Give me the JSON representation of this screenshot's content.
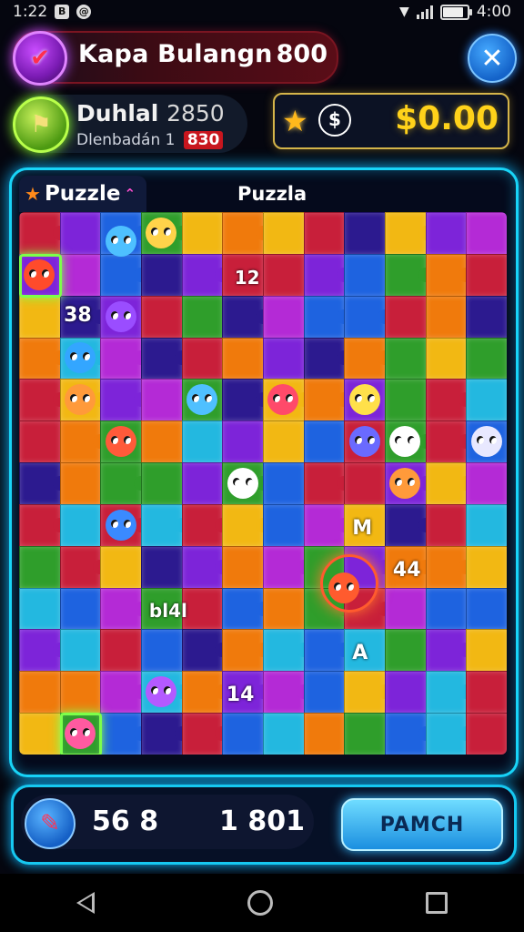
{
  "status_bar": {
    "time": "1:22",
    "clock": "4:00"
  },
  "header": {
    "title": "Kapa Bulangn",
    "count": "800"
  },
  "player": {
    "name": "Duhlal",
    "score": "2850",
    "subtitle": "Dlenbadán",
    "sub_num": "1",
    "badge": "830"
  },
  "wallet": {
    "amount": "$0.00"
  },
  "board_tabs": {
    "tab_label": "Puzzle",
    "title": "Puzzla"
  },
  "board_labels": [
    "12",
    "38",
    "M",
    "44",
    "bl4l",
    "14",
    "A"
  ],
  "footer": {
    "left_value": "56 8",
    "right_value": "1 801",
    "action_label": "PAMCH"
  },
  "colors": {
    "accent_cyan": "#18d4f7",
    "gold": "#ffd21a",
    "piece_palette": [
      "#2f9e2b",
      "#7d24d9",
      "#f07a0c",
      "#1e63e0",
      "#c81f3a",
      "#f2b813",
      "#2c1a8f",
      "#23b8e0",
      "#b42ad6"
    ]
  },
  "icons": {
    "heart": "heart-icon",
    "close": "close-icon",
    "level": "trophy-icon",
    "star": "star-icon",
    "dollar": "dollar-icon",
    "pencil": "pencil-icon"
  }
}
